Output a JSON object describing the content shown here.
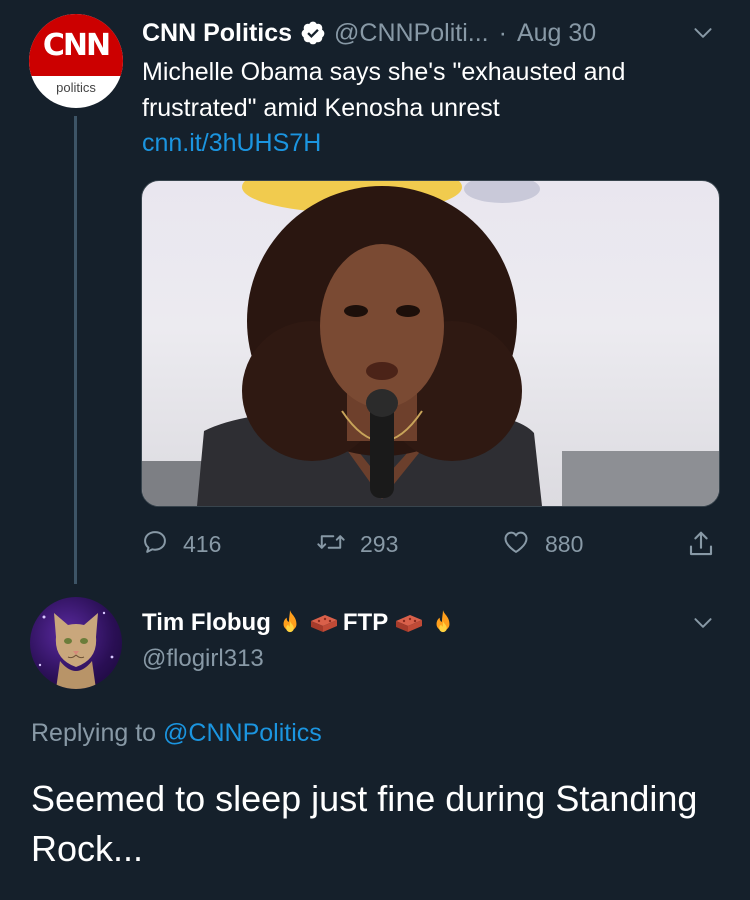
{
  "tweet": {
    "avatar_logo_text": "CNN",
    "avatar_sub_text": "politics",
    "author_name": "CNN Politics",
    "author_handle": "@CNNPoliti...",
    "separator": "·",
    "date": "Aug 30",
    "text": "Michelle Obama says she's \"exhausted and frustrated\" amid Kenosha unrest",
    "link": "cnn.it/3hUHS7H",
    "stats": {
      "replies": "416",
      "retweets": "293",
      "likes": "880"
    }
  },
  "reply": {
    "author_name": "Tim Flobug",
    "name_tag": "FTP",
    "author_handle": "@flogirl313",
    "replying_prefix": "Replying to",
    "replying_mention": "@CNNPolitics",
    "text": "Seemed to sleep just fine during Standing Rock..."
  },
  "icons": {
    "verified": "verified-badge-icon",
    "caret": "chevron-down-icon",
    "reply": "reply-bubble-icon",
    "retweet": "retweet-icon",
    "like": "heart-icon",
    "share": "share-icon",
    "fire": "fire-emoji-icon",
    "brick": "brick-emoji-icon"
  },
  "colors": {
    "background": "#15202b",
    "secondary_text": "#8899a6",
    "link": "#1b95e0",
    "verified": "#ffffff",
    "cnn_red": "#cc0000"
  }
}
